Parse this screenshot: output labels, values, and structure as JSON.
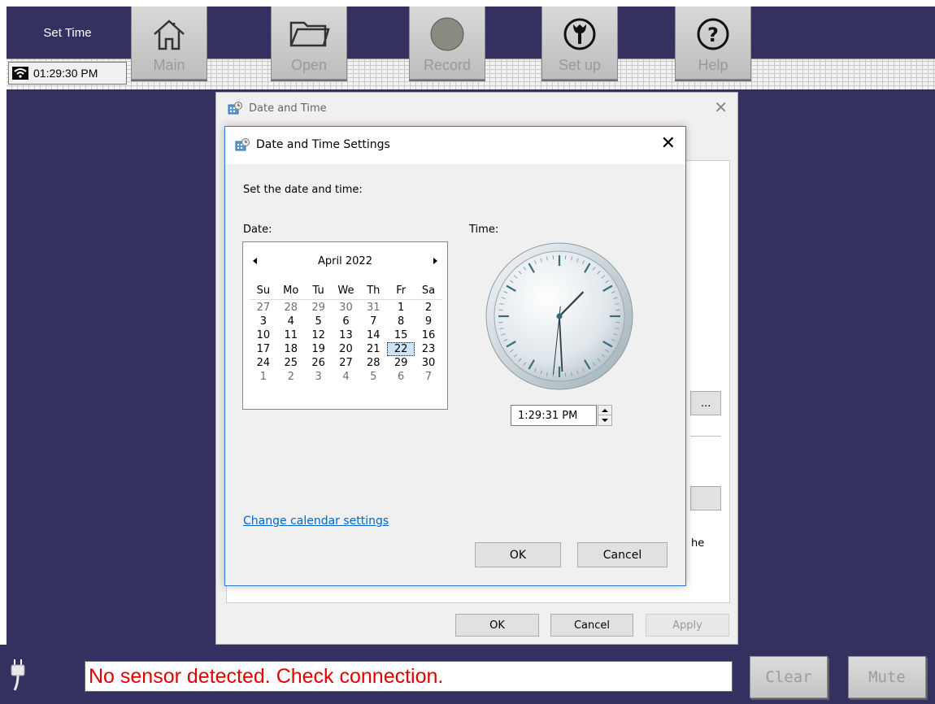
{
  "toolbar": {
    "title": "Set Time",
    "clock": "01:29:30 PM",
    "buttons": [
      {
        "label": "Main",
        "icon": "home-icon"
      },
      {
        "label": "Open",
        "icon": "folder-icon"
      },
      {
        "label": "Record",
        "icon": "record-icon"
      },
      {
        "label": "Set up",
        "icon": "wrench-icon"
      },
      {
        "label": "Help",
        "icon": "help-icon"
      }
    ]
  },
  "outer_dialog": {
    "title": "Date and Time",
    "partial_button": "...",
    "partial_text": "he",
    "ok": "OK",
    "cancel": "Cancel",
    "apply": "Apply"
  },
  "inner_dialog": {
    "title": "Date and Time Settings",
    "set_label": "Set the date and time:",
    "date_label": "Date:",
    "time_label": "Time:",
    "calendar": {
      "month": "April 2022",
      "weekdays": [
        "Su",
        "Mo",
        "Tu",
        "We",
        "Th",
        "Fr",
        "Sa"
      ],
      "weeks": [
        [
          "27",
          "28",
          "29",
          "30",
          "31",
          "1",
          "2"
        ],
        [
          "3",
          "4",
          "5",
          "6",
          "7",
          "8",
          "9"
        ],
        [
          "10",
          "11",
          "12",
          "13",
          "14",
          "15",
          "16"
        ],
        [
          "17",
          "18",
          "19",
          "20",
          "21",
          "22",
          "23"
        ],
        [
          "24",
          "25",
          "26",
          "27",
          "28",
          "29",
          "30"
        ],
        [
          "1",
          "2",
          "3",
          "4",
          "5",
          "6",
          "7"
        ]
      ],
      "selected": "22"
    },
    "time_value": "1:29:31 PM",
    "change_calendar_link": "Change calendar settings",
    "ok": "OK",
    "cancel": "Cancel"
  },
  "status": {
    "message": "No sensor detected. Check connection.",
    "clear": "Clear",
    "mute": "Mute",
    "message_color": "#e00000"
  },
  "colors": {
    "app_background": "#34305f",
    "dialog_border": "#2b79d6",
    "link": "#0066cc"
  }
}
